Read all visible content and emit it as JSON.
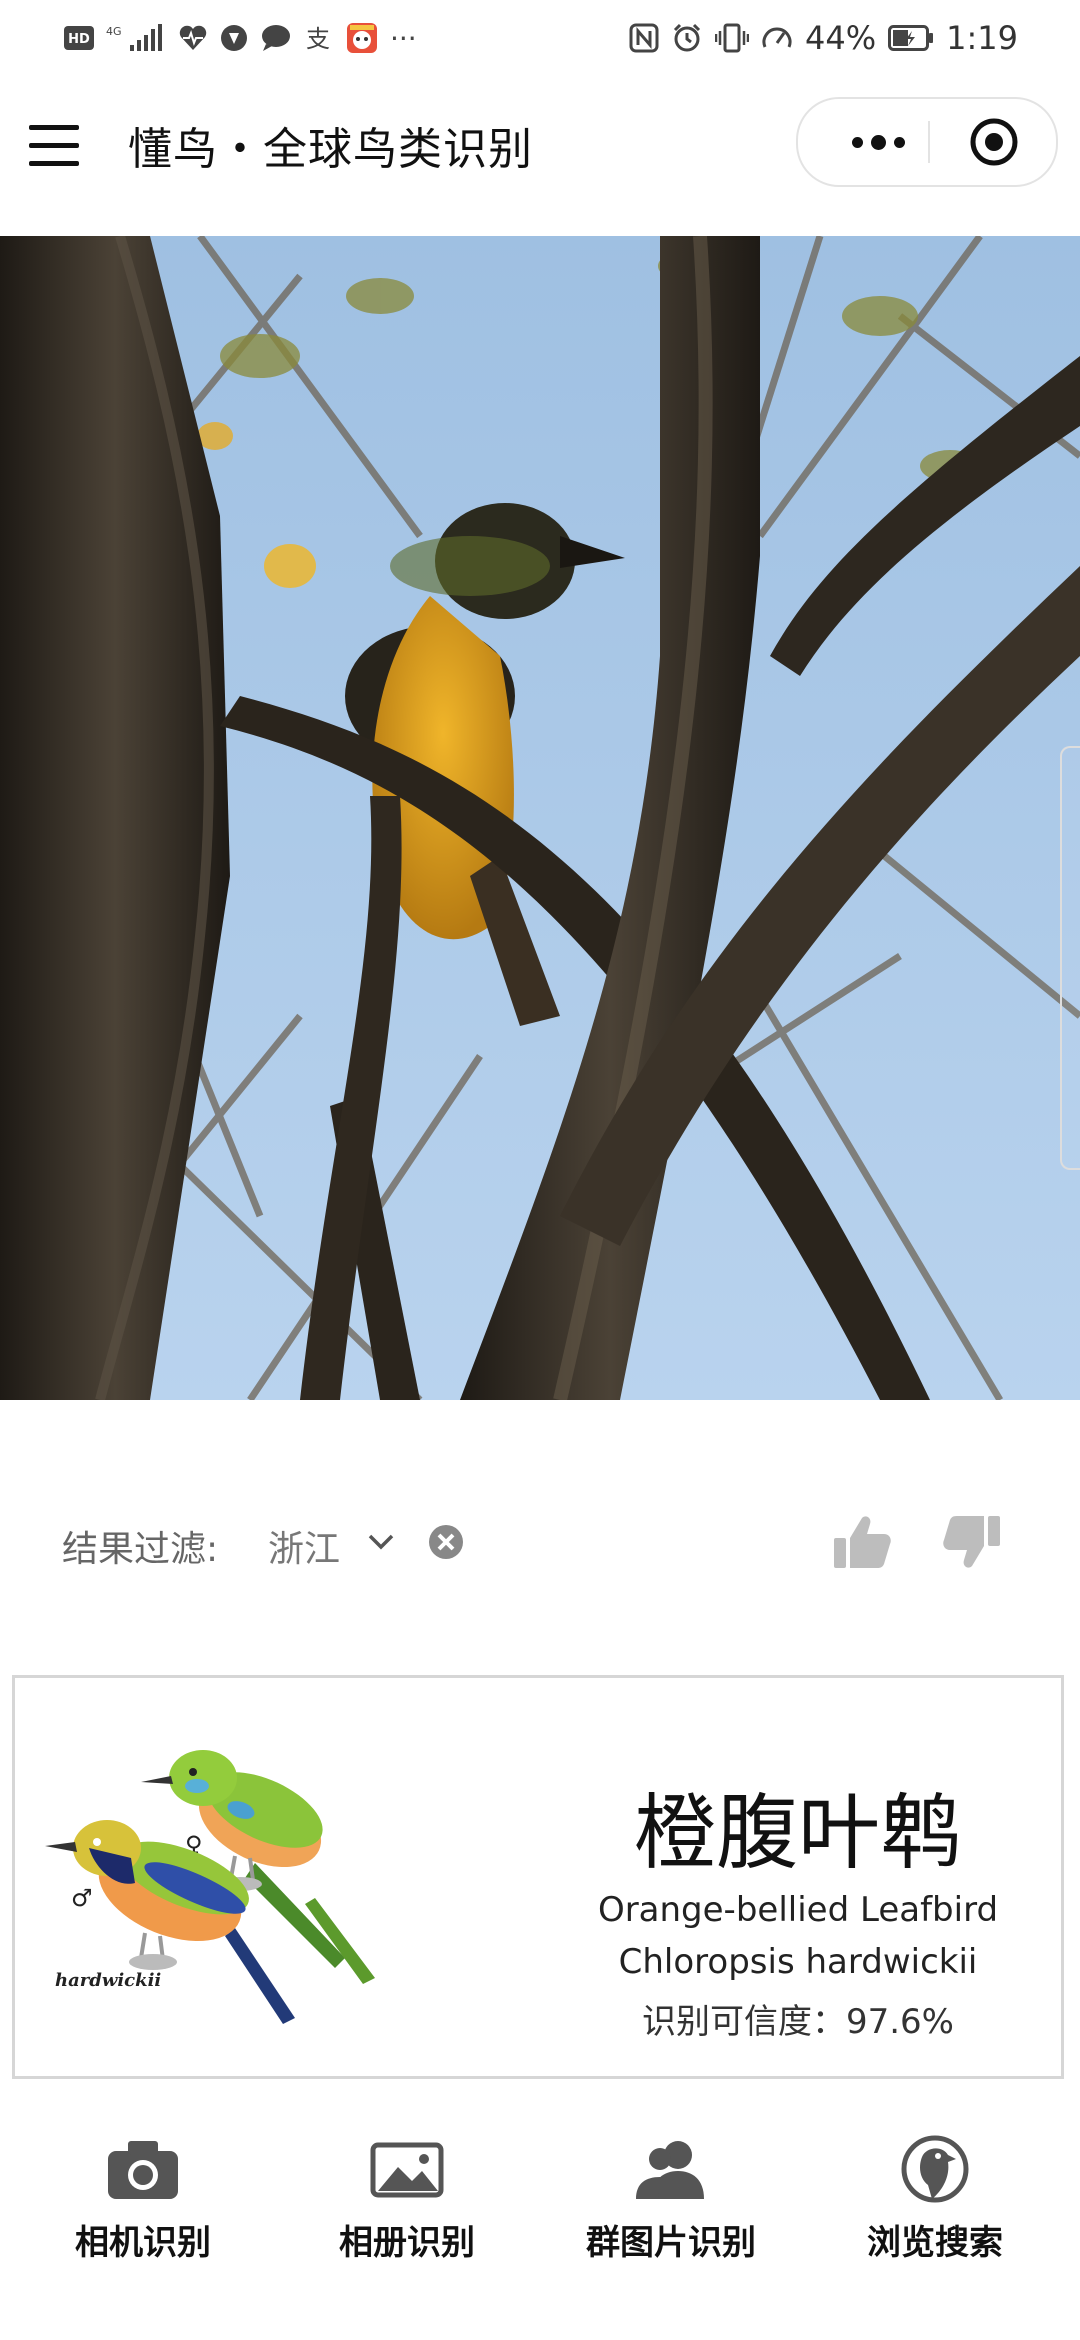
{
  "status_bar": {
    "left_badges": [
      "HD",
      "4G"
    ],
    "more": "···",
    "battery": "44%",
    "time": "1:19"
  },
  "header": {
    "title": "懂鸟・全球鸟类识别"
  },
  "filter": {
    "label": "结果过滤:",
    "region": "浙江"
  },
  "result": {
    "name_cn": "橙腹叶鹎",
    "name_en": "Orange-bellied Leafbird",
    "name_sci": "Chloropsis hardwickii",
    "confidence": "识别可信度：97.6%",
    "art": {
      "female_symbol": "♀",
      "male_symbol": "♂",
      "caption": "hardwickii"
    }
  },
  "tabs": [
    {
      "label": "相机识别",
      "icon": "camera-icon"
    },
    {
      "label": "相册识别",
      "icon": "image-icon"
    },
    {
      "label": "群图片识别",
      "icon": "group-icon"
    },
    {
      "label": "浏览搜索",
      "icon": "bird-search-icon"
    }
  ],
  "colors": {
    "sky": "#a9c8e8",
    "bird_body": "#e3a51c",
    "bark": "#3d342a",
    "card_border": "#d6d6d6"
  }
}
